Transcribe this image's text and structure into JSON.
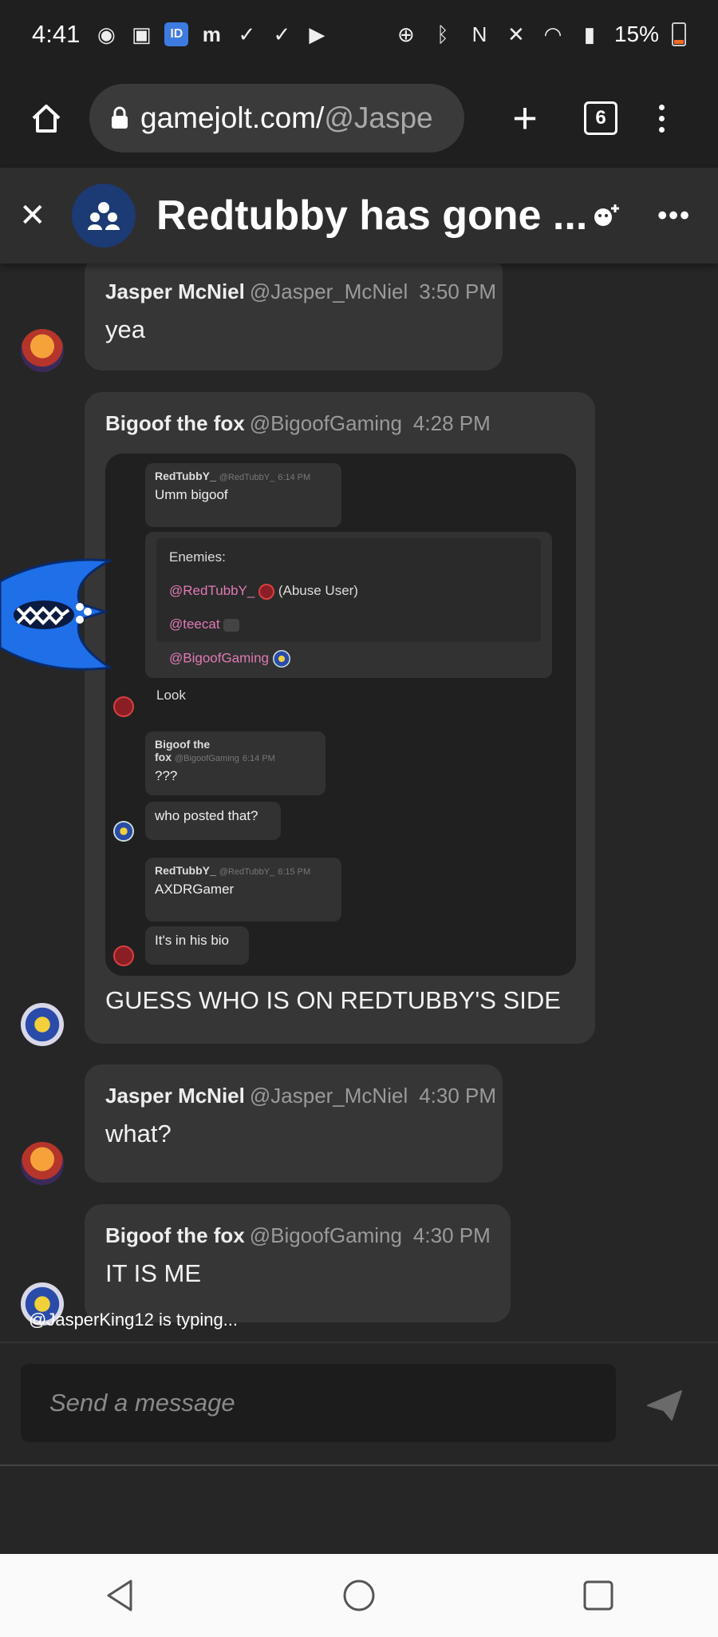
{
  "status_bar": {
    "time": "4:41",
    "battery": "15%",
    "left_icons": [
      "discord-icon",
      "image-icon",
      "app-icon",
      "m-zone-icon",
      "check-icon",
      "check-icon",
      "youtube-icon"
    ],
    "right_icons": [
      "data-saver-icon",
      "bluetooth-icon",
      "nfc-icon",
      "mute-icon",
      "wifi-icon",
      "signal-icon"
    ]
  },
  "browser": {
    "url_host": "gamejolt.com/",
    "url_path": "@Jaspe",
    "tab_count": "6"
  },
  "chat": {
    "title": "Redtubby has gone ..."
  },
  "messages": [
    {
      "name": "Jasper McNiel",
      "handle": "@Jasper_McNiel",
      "time": "3:50 PM",
      "text": "yea"
    },
    {
      "name": "Bigoof the fox",
      "handle": "@BigoofGaming",
      "time": "4:28 PM",
      "text": "GUESS WHO IS ON REDTUBBY'S SIDE"
    },
    {
      "name": "Jasper McNiel",
      "handle": "@Jasper_McNiel",
      "time": "4:30 PM",
      "text": "what?"
    },
    {
      "name": "Bigoof the fox",
      "handle": "@BigoofGaming",
      "time": "4:30 PM",
      "text": "IT IS ME"
    }
  ],
  "embedded_screenshot": {
    "m1": {
      "name": "RedTubbY_",
      "handle": "@RedTubbY_",
      "time": "6:14 PM",
      "text": "Umm bigoof"
    },
    "enemies_label": "Enemies:",
    "enemy1": "@RedTubbY_",
    "enemy1_note": "(Abuse User)",
    "enemy2": "@teecat",
    "enemy3": "@BigoofGaming",
    "look": "Look",
    "m2": {
      "name": "Bigoof the fox",
      "handle": "@BigoofGaming",
      "time": "6:14 PM",
      "text": "???"
    },
    "m3_text": "who posted that?",
    "m4": {
      "name": "RedTubbY_",
      "handle": "@RedTubbY_",
      "time": "6:15 PM",
      "text": "AXDRGamer"
    },
    "m5_text": "It's in his bio"
  },
  "typing_indicator": "@JasperKing12 is typing...",
  "composer": {
    "placeholder": "Send a message"
  },
  "colors": {
    "background": "#262626",
    "bubble": "#363636",
    "header": "#2e2e2e",
    "group_avatar": "#1c3a73",
    "mention": "#e07ab5"
  }
}
